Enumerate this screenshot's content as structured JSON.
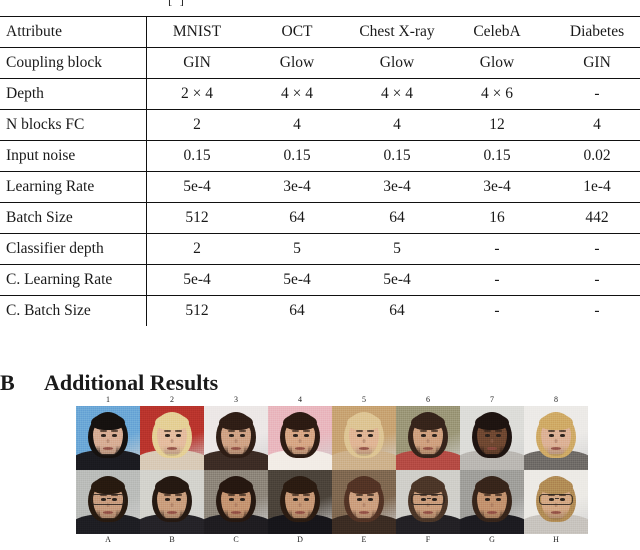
{
  "top_fragment": "[  ]",
  "table": {
    "columns": [
      "Attribute",
      "MNIST",
      "OCT",
      "Chest X-ray",
      "CelebA",
      "Diabetes"
    ],
    "rows": [
      {
        "attribute": "Coupling block",
        "values": [
          "GIN",
          "Glow",
          "Glow",
          "Glow",
          "GIN"
        ]
      },
      {
        "attribute": "Depth",
        "values": [
          "2 × 4",
          "4 × 4",
          "4 × 4",
          "4 × 6",
          "-"
        ]
      },
      {
        "attribute": "N blocks FC",
        "values": [
          "2",
          "4",
          "4",
          "12",
          "4"
        ]
      },
      {
        "attribute": "Input noise",
        "values": [
          "0.15",
          "0.15",
          "0.15",
          "0.15",
          "0.02"
        ]
      },
      {
        "attribute": "Learning Rate",
        "values": [
          "5e-4",
          "3e-4",
          "3e-4",
          "3e-4",
          "1e-4"
        ]
      },
      {
        "attribute": "Batch Size",
        "values": [
          "512",
          "64",
          "64",
          "16",
          "442"
        ]
      },
      {
        "attribute": "Classifier depth",
        "values": [
          "2",
          "5",
          "5",
          "-",
          "-"
        ]
      },
      {
        "attribute": "C. Learning Rate",
        "values": [
          "5e-4",
          "5e-4",
          "5e-4",
          "-",
          "-"
        ]
      },
      {
        "attribute": "C. Batch Size",
        "values": [
          "512",
          "64",
          "64",
          "-",
          "-"
        ]
      }
    ]
  },
  "section": {
    "number": "B",
    "title": "Additional Results"
  },
  "figure": {
    "column_labels": [
      "1",
      "2",
      "3",
      "4",
      "5",
      "6",
      "7",
      "8"
    ],
    "bottom_labels": [
      "A",
      "B",
      "C",
      "D",
      "E",
      "F",
      "G",
      "H"
    ],
    "rows": 2,
    "columns": 8,
    "cells": [
      {
        "id": "r1c1",
        "label": "1",
        "description": "woman with dark black bob hair, blue sky background",
        "bg": "#6aa6d6",
        "skin": "#d7ac93",
        "hair": "#15110f",
        "cloth": "#1b1b20"
      },
      {
        "id": "r1c2",
        "label": "2",
        "description": "blonde woman in front of red and white signage",
        "bg": "#b8332c",
        "skin": "#e4bb9d",
        "hair": "#e4cf94",
        "cloth": "#d8c9b6"
      },
      {
        "id": "r1c3",
        "label": "3",
        "description": "brunette woman, light pink-white backdrop",
        "bg": "#ece7e6",
        "skin": "#cfa183",
        "hair": "#2e1d15",
        "cloth": "#3b2b24"
      },
      {
        "id": "r1c4",
        "label": "4",
        "description": "brunette woman arm raised, pink backdrop",
        "bg": "#e9b6bd",
        "skin": "#d6a583",
        "hair": "#2b1a12",
        "cloth": "#f2ece6"
      },
      {
        "id": "r1c5",
        "label": "5",
        "description": "blonde woman, warm golden interior background",
        "bg": "#c7a271",
        "skin": "#e0b493",
        "hair": "#ddc492",
        "cloth": "#cdb08a"
      },
      {
        "id": "r1c6",
        "label": "6",
        "description": "brunette woman hands in hair, olive background",
        "bg": "#9a9576",
        "skin": "#cf9f7d",
        "hair": "#35231a",
        "cloth": "#b44a43"
      },
      {
        "id": "r1c7",
        "label": "7",
        "description": "dark-skinned man smiling, light grey backdrop",
        "bg": "#dcdcd8",
        "skin": "#6d4630",
        "hair": "#1d1310",
        "cloth": "#b9b6b1"
      },
      {
        "id": "r1c8",
        "label": "8",
        "description": "blonde woman, white background",
        "bg": "#eceae7",
        "skin": "#dcb094",
        "hair": "#cfa964",
        "cloth": "#6e6a66"
      },
      {
        "id": "r2c1",
        "label": "A",
        "description": "generated male face with glasses, grey background",
        "bg": "#b9bbb8",
        "skin": "#c89b7c",
        "hair": "#26190f",
        "cloth": "#1d1d22",
        "glasses": true
      },
      {
        "id": "r2c2",
        "label": "B",
        "description": "generated male face, light grey background",
        "bg": "#d3d2cc",
        "skin": "#c99c7b",
        "hair": "#241811",
        "cloth": "#242227",
        "glasses": false
      },
      {
        "id": "r2c3",
        "label": "C",
        "description": "generated male face, dark patterned background",
        "bg": "#8b8378",
        "skin": "#c4926f",
        "hair": "#251710",
        "cloth": "#1e1c20",
        "glasses": false
      },
      {
        "id": "r2c4",
        "label": "D",
        "description": "generated male face, dark background",
        "bg": "#4a4239",
        "skin": "#c69673",
        "hair": "#2a1b11",
        "cloth": "#16151a",
        "glasses": false
      },
      {
        "id": "r2c5",
        "label": "E",
        "description": "generated female face with long hair, brown background",
        "bg": "#7d664f",
        "skin": "#cb9d7c",
        "hair": "#513224",
        "cloth": "#3a2b22",
        "glasses": false
      },
      {
        "id": "r2c6",
        "label": "F",
        "description": "generated male face with glasses, light grey background",
        "bg": "#cfcec8",
        "skin": "#c99b79",
        "hair": "#4a3527",
        "cloth": "#222024",
        "glasses": true
      },
      {
        "id": "r2c7",
        "label": "G",
        "description": "generated male face with shaggy hair, grey background",
        "bg": "#9e9d99",
        "skin": "#c2906c",
        "hair": "#36241a",
        "cloth": "#1c1b20",
        "glasses": false
      },
      {
        "id": "r2c8",
        "label": "H",
        "description": "generated female face with glasses and blonde hair, white background",
        "bg": "#eceae5",
        "skin": "#d3a682",
        "hair": "#b08a54",
        "cloth": "#c7c3bd",
        "glasses": true
      }
    ]
  }
}
